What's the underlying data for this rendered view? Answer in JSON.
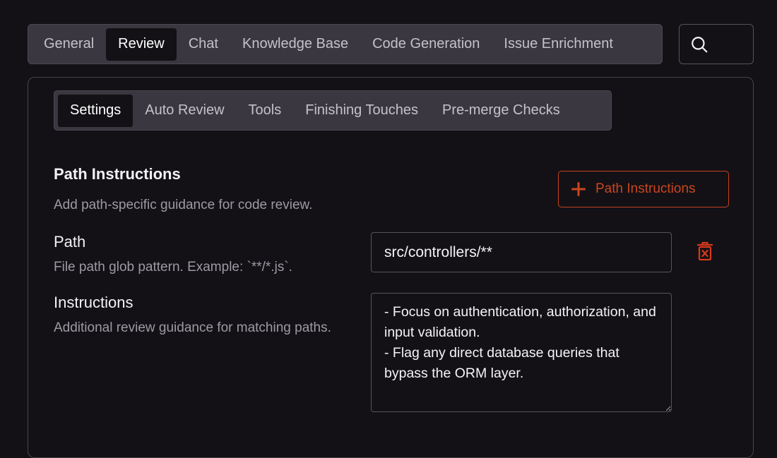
{
  "top_tabs": [
    {
      "label": "General",
      "active": false
    },
    {
      "label": "Review",
      "active": true
    },
    {
      "label": "Chat",
      "active": false
    },
    {
      "label": "Knowledge Base",
      "active": false
    },
    {
      "label": "Code Generation",
      "active": false
    },
    {
      "label": "Issue Enrichment",
      "active": false
    }
  ],
  "sub_tabs": [
    {
      "label": "Settings",
      "active": true
    },
    {
      "label": "Auto Review",
      "active": false
    },
    {
      "label": "Tools",
      "active": false
    },
    {
      "label": "Finishing Touches",
      "active": false
    },
    {
      "label": "Pre-merge Checks",
      "active": false
    }
  ],
  "section": {
    "title": "Path Instructions",
    "description": "Add path-specific guidance for code review.",
    "add_button_label": "Path Instructions"
  },
  "path_field": {
    "label": "Path",
    "help": "File path glob pattern. Example: `**/*.js`.",
    "value": "src/controllers/**"
  },
  "instructions_field": {
    "label": "Instructions",
    "help": "Additional review guidance for matching paths.",
    "value": "- Focus on authentication, authorization, and input validation.\n- Flag any direct database queries that bypass the ORM layer."
  },
  "icons": {
    "search": "search-icon",
    "add": "plus-icon",
    "delete": "trash-icon"
  },
  "colors": {
    "accent": "#c9461f",
    "background": "#141116",
    "tab_bar": "#3a3740"
  }
}
